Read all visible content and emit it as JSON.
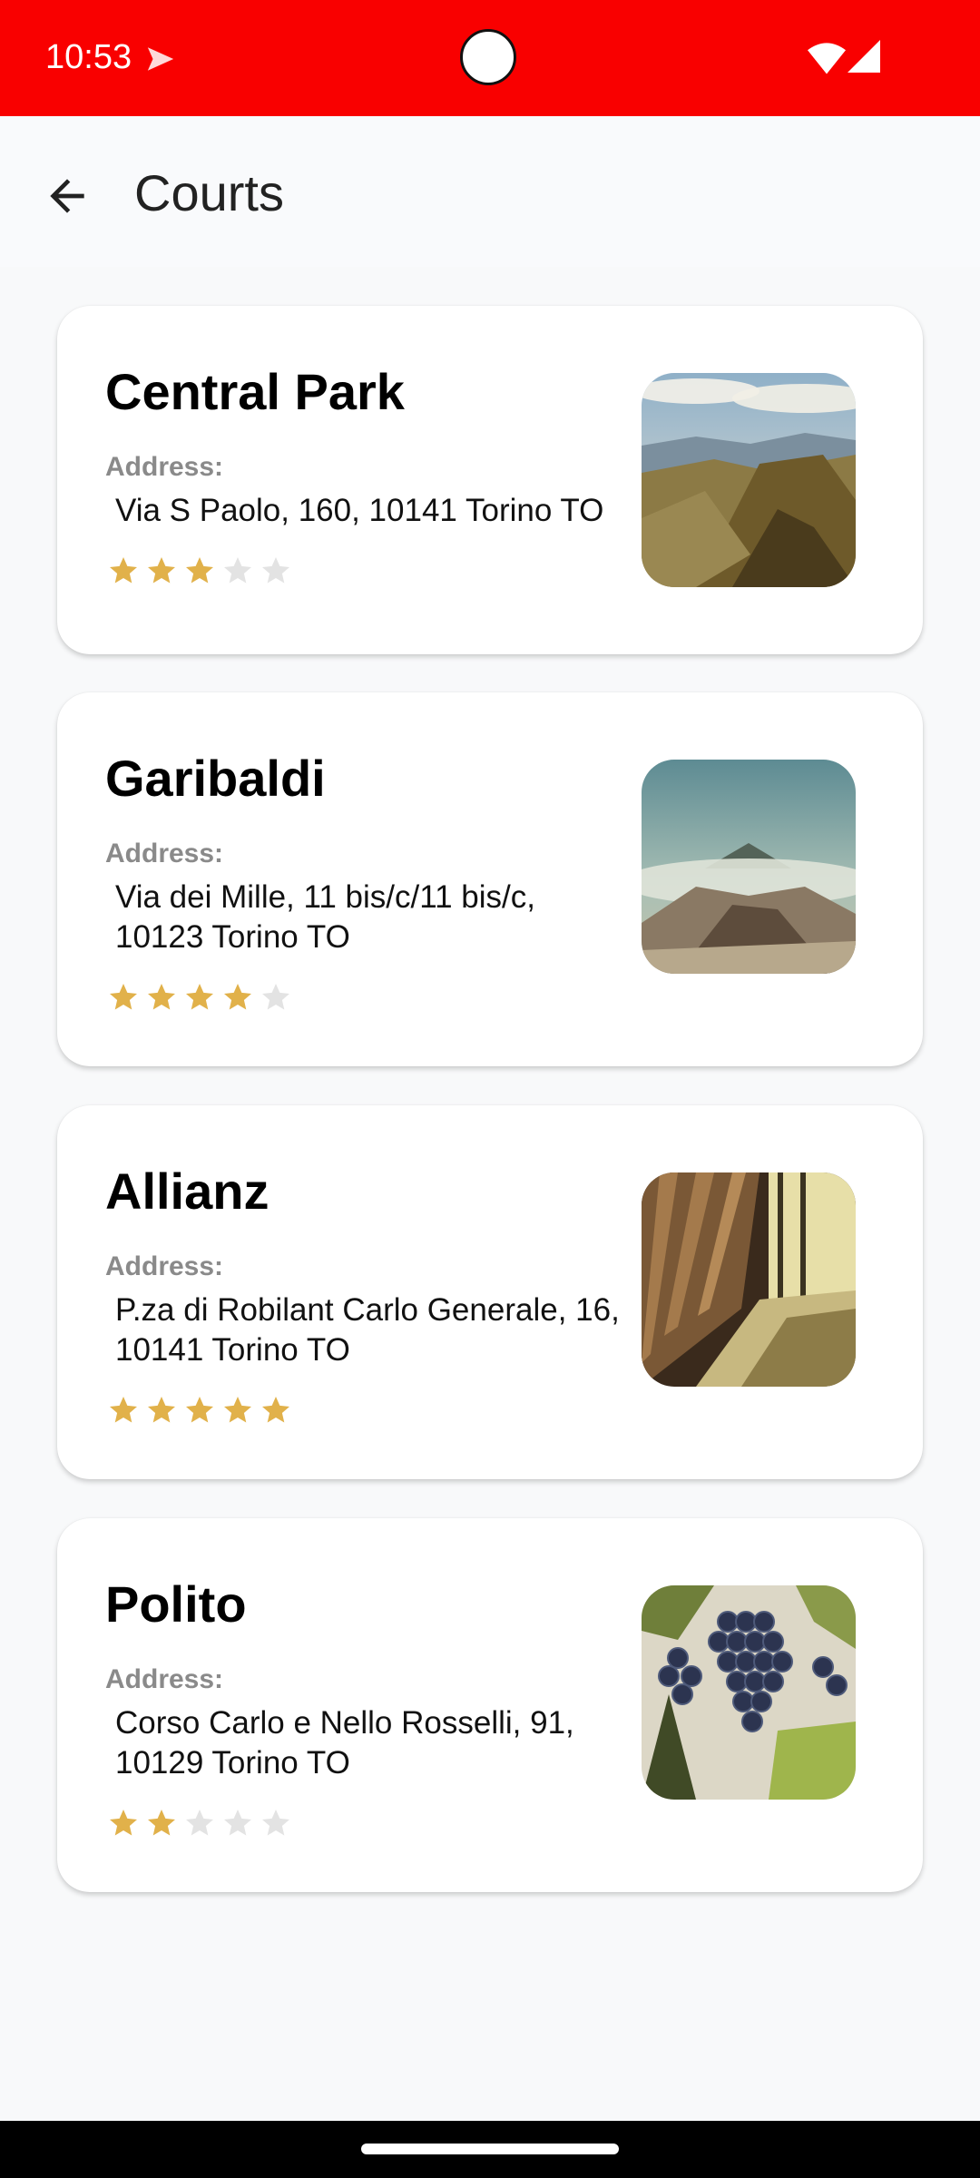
{
  "status_bar": {
    "time": "10:53",
    "icons": [
      "send-icon",
      "camera-cutout",
      "wifi-icon",
      "signal-icon"
    ],
    "color": "#f90000"
  },
  "app_bar": {
    "title": "Courts",
    "back_icon": "arrow-left-icon"
  },
  "courts": [
    {
      "name": "Central Park",
      "address_label": "Address:",
      "address": "Via S Paolo, 160, 10141 Torino TO",
      "rating": 3,
      "max_rating": 5,
      "image": "mountain-ridge-photo"
    },
    {
      "name": "Garibaldi",
      "address_label": "Address:",
      "address": "Via dei Mille, 11 bis/c/11 bis/c, 10123 Torino TO",
      "rating": 4,
      "max_rating": 5,
      "image": "volcano-photo"
    },
    {
      "name": "Allianz",
      "address_label": "Address:",
      "address": "P.za di Robilant Carlo Generale, 16, 10141 Torino TO",
      "rating": 5,
      "max_rating": 5,
      "image": "wine-barrels-photo"
    },
    {
      "name": "Polito",
      "address_label": "Address:",
      "address": "Corso Carlo e Nello Rosselli, 91, 10129 Torino TO",
      "rating": 2,
      "max_rating": 5,
      "image": "grapes-photo"
    }
  ],
  "colors": {
    "star_filled": "#e1b14a",
    "star_empty": "#e3e3e3",
    "address_label": "#8a8a8a"
  }
}
